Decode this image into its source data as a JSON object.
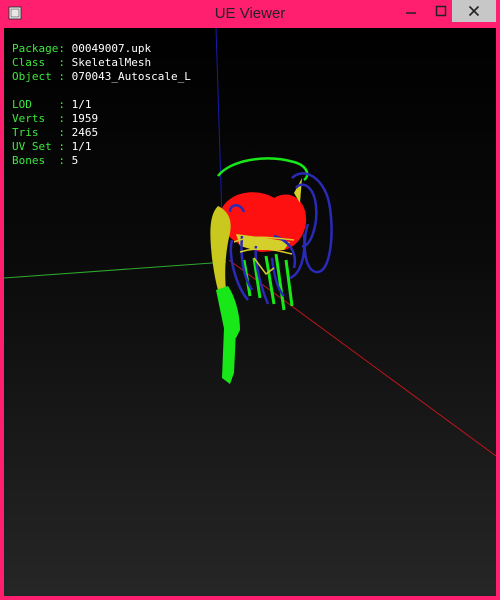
{
  "window": {
    "title": "UE Viewer"
  },
  "info": {
    "package": {
      "label": "Package:",
      "value": "00049007.upk"
    },
    "class": {
      "label": "Class  :",
      "value": "SkeletalMesh"
    },
    "object": {
      "label": "Object :",
      "value": "070043_Autoscale_L"
    },
    "lod": {
      "label": "LOD    :",
      "value": "1/1"
    },
    "verts": {
      "label": "Verts  :",
      "value": "1959"
    },
    "tris": {
      "label": "Tris   :",
      "value": "2465"
    },
    "uvset": {
      "label": "UV Set :",
      "value": "1/1"
    },
    "bones": {
      "label": "Bones  :",
      "value": "5"
    }
  },
  "colors": {
    "titlebar": "#ff1f6e",
    "label_green": "#3ee83e",
    "value_white": "#ffffff",
    "axis_red": "#c0141e",
    "axis_green": "#2ea82e",
    "axis_blue": "#1a1aa8"
  }
}
